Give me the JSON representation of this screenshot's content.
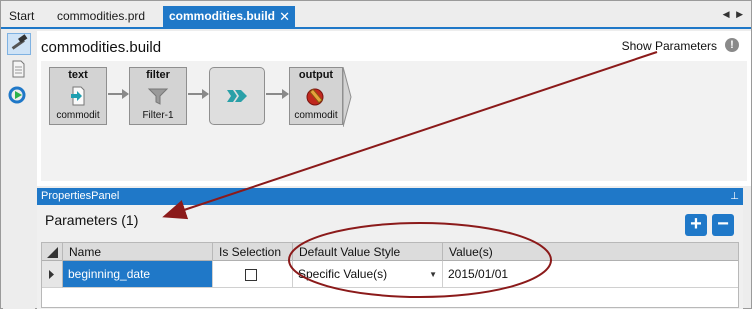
{
  "tabs": [
    {
      "label": "Start"
    },
    {
      "label": "commodities.prd"
    },
    {
      "label": "commodities.build",
      "close": "✕"
    }
  ],
  "tab_scroll": "◀ ▶",
  "editor": {
    "title": "commodities.build",
    "show_parameters": "Show Parameters",
    "warning_glyph": "!"
  },
  "flow": {
    "nodes": [
      {
        "title": "text",
        "sub": "commodit"
      },
      {
        "title": "filter",
        "sub": "Filter-1"
      },
      {
        "title": "",
        "sub": ""
      },
      {
        "title": "output",
        "sub": "commodit"
      }
    ]
  },
  "properties_panel": {
    "header": "PropertiesPanel",
    "pin": "⊥",
    "title": "Parameters (1)",
    "add_label": "+",
    "remove_label": "−",
    "columns": [
      "Name",
      "Is Selection",
      "Default Value Style",
      "Value(s)"
    ],
    "rows": [
      {
        "name": "beginning_date",
        "is_selection": false,
        "default_value_style": "Specific Value(s)",
        "values": "2015/01/01"
      }
    ]
  },
  "colors": {
    "accent": "#1f78c8",
    "annotation": "#8b1a1a"
  }
}
